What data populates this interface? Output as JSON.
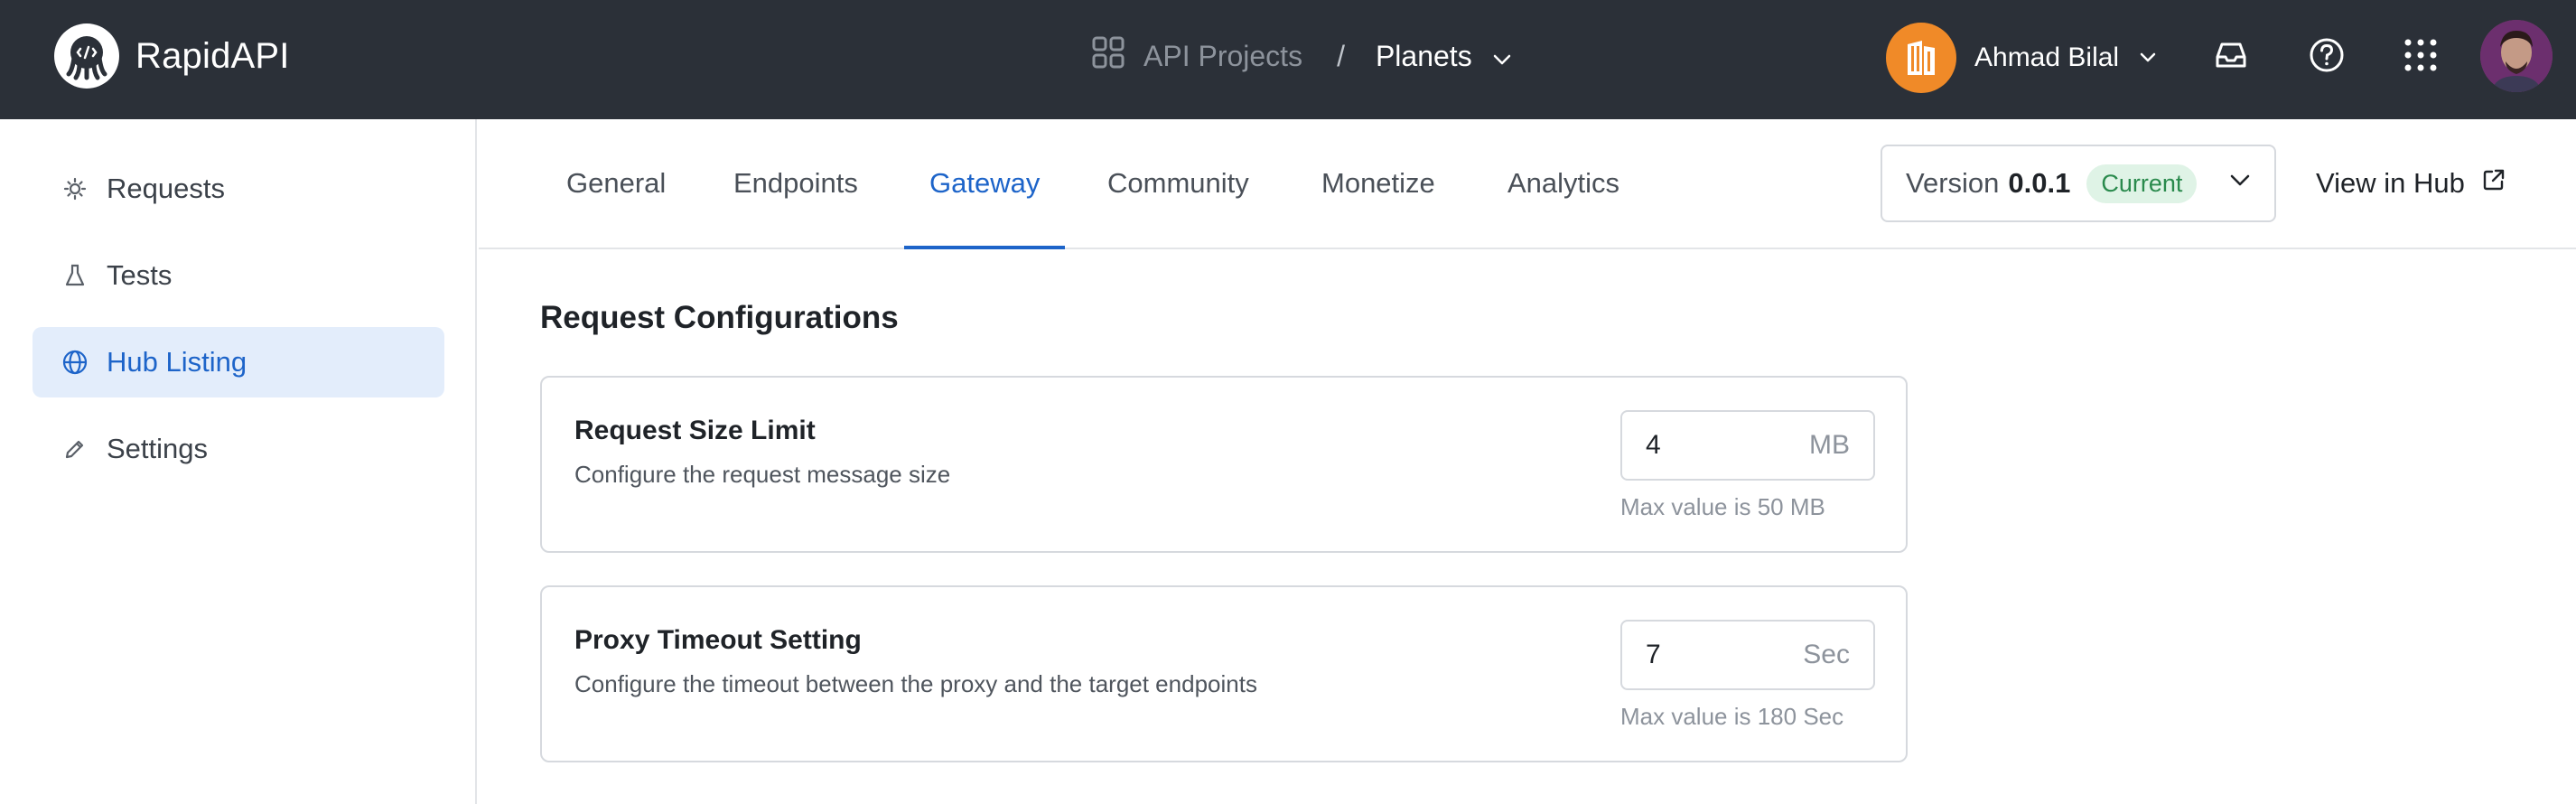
{
  "topbar": {
    "brand_name": "RapidAPI",
    "breadcrumb_projects": "API Projects",
    "breadcrumb_separator": "/",
    "breadcrumb_current": "Planets",
    "user_name": "Ahmad Bilal"
  },
  "sidebar": {
    "items": [
      {
        "label": "Requests",
        "icon": "requests-icon",
        "active": false
      },
      {
        "label": "Tests",
        "icon": "flask-icon",
        "active": false
      },
      {
        "label": "Hub Listing",
        "icon": "globe-icon",
        "active": true
      },
      {
        "label": "Settings",
        "icon": "pencil-icon",
        "active": false
      }
    ]
  },
  "tabs": {
    "items": [
      {
        "label": "General",
        "active": false
      },
      {
        "label": "Endpoints",
        "active": false
      },
      {
        "label": "Gateway",
        "active": true
      },
      {
        "label": "Community",
        "active": false
      },
      {
        "label": "Monetize",
        "active": false
      },
      {
        "label": "Analytics",
        "active": false
      }
    ],
    "version_label": "Version",
    "version_number": "0.0.1",
    "version_badge": "Current",
    "view_in_hub": "View in Hub"
  },
  "main": {
    "section_title": "Request Configurations",
    "cards": [
      {
        "title": "Request Size Limit",
        "description": "Configure the request message size",
        "value": "4",
        "unit": "MB",
        "hint": "Max value is 50 MB"
      },
      {
        "title": "Proxy Timeout Setting",
        "description": "Configure the timeout between the proxy and the target endpoints",
        "value": "7",
        "unit": "Sec",
        "hint": "Max value is 180 Sec"
      }
    ]
  },
  "colors": {
    "topbar_bg": "#2b3038",
    "accent": "#1d64c9",
    "active_bg": "#e3edfb",
    "badge_bg": "#dff3e6",
    "badge_text": "#2a8a4d",
    "org_avatar": "#f08a28"
  }
}
